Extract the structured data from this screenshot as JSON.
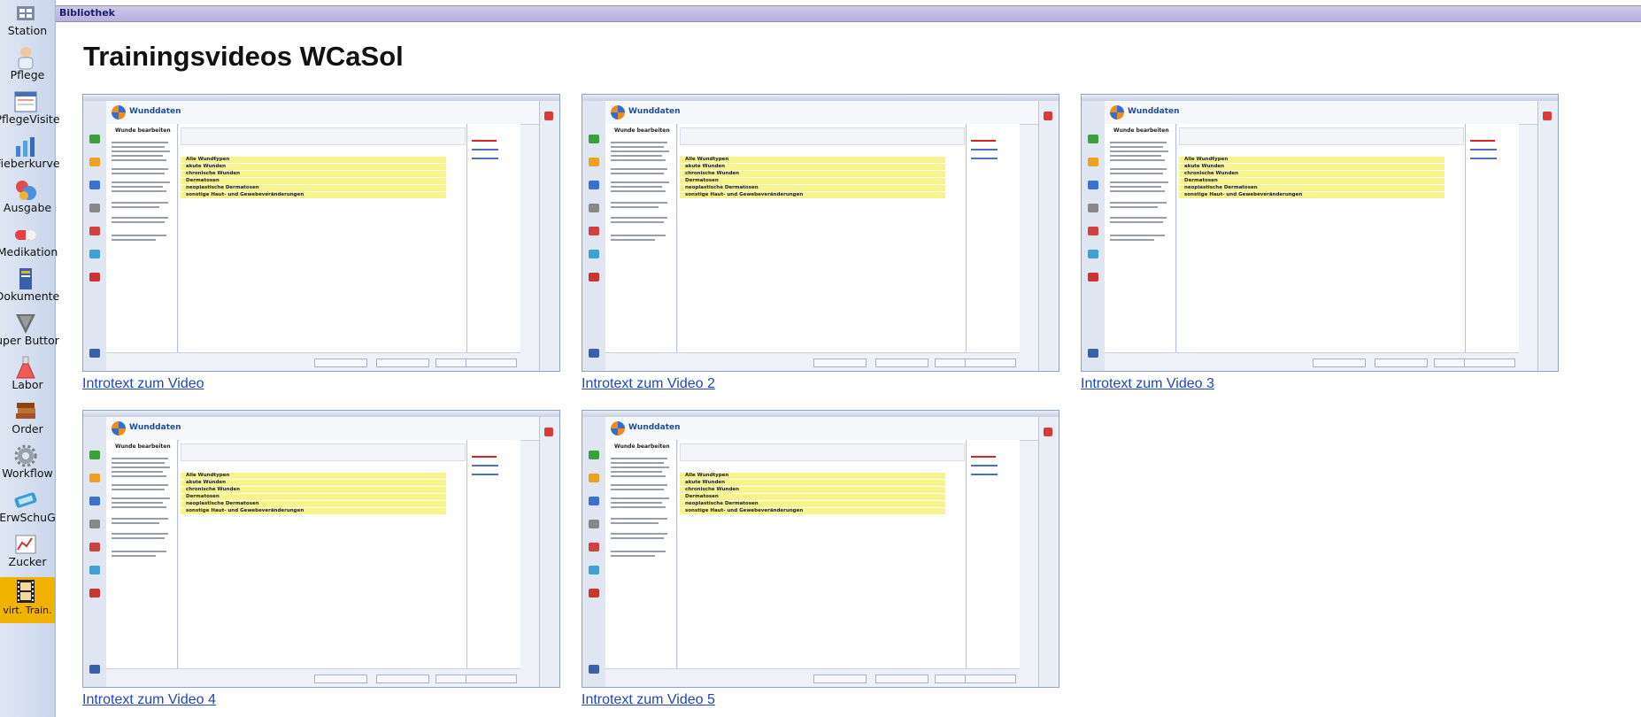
{
  "sidebar": {
    "items": [
      {
        "label": "Station",
        "icon": "station-icon"
      },
      {
        "label": "Pflege",
        "icon": "nurse-icon"
      },
      {
        "label": "PflegeVisite",
        "icon": "care-visit-icon"
      },
      {
        "label": "Fieberkurve",
        "icon": "fever-chart-icon"
      },
      {
        "label": "Ausgabe",
        "icon": "dispense-icon"
      },
      {
        "label": "Medikation",
        "icon": "medication-icon"
      },
      {
        "label": "Dokumente",
        "icon": "documents-icon"
      },
      {
        "label": "uper Buttor",
        "icon": "super-button-icon"
      },
      {
        "label": "Labor",
        "icon": "lab-flask-icon"
      },
      {
        "label": "Order",
        "icon": "order-books-icon"
      },
      {
        "label": "Workflow",
        "icon": "workflow-gear-icon"
      },
      {
        "label": "ErwSchuG",
        "icon": "erwschug-icon"
      },
      {
        "label": "Zucker",
        "icon": "sugar-chart-icon"
      },
      {
        "label": "virt. Train.",
        "icon": "film-strip-icon",
        "active": true
      }
    ]
  },
  "tabbar": {
    "label": "Bibliothek"
  },
  "page": {
    "title": "Trainingsvideos WCaSol"
  },
  "videos": [
    {
      "link": "Introtext zum Video"
    },
    {
      "link": "Introtext zum Video 2"
    },
    {
      "link": "Introtext zum Video 3"
    },
    {
      "link": "Introtext zum Video 4"
    },
    {
      "link": "Introtext zum Video 5"
    }
  ],
  "thumbnail": {
    "brand": "Wunddaten",
    "help_heading": "Wunde bearbeiten",
    "wound_types": [
      "Alle Wundtypen",
      "akute Wunden",
      "chronische Wunden",
      "Dermatosen",
      "neoplastische Dermatosen",
      "sonstige Haut- und Gewebeveränderungen"
    ]
  },
  "colors": {
    "sidebar_active": "#f2b300",
    "tabbar": "#c4bbe4",
    "link": "#1f45c2"
  }
}
